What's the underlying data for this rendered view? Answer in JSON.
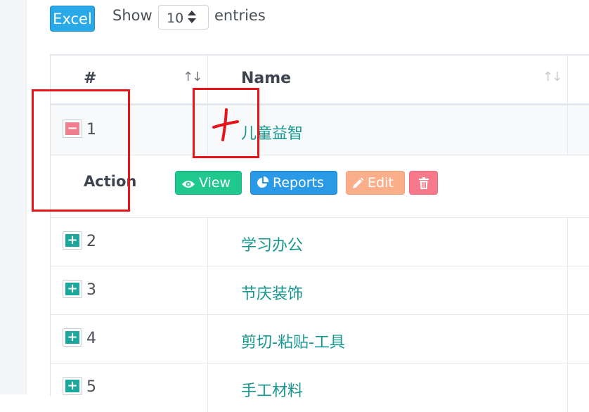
{
  "toolbar": {
    "excel_label": "Excel",
    "show_label": "Show",
    "entries_value": "10",
    "entries_label": "entries"
  },
  "table": {
    "columns": [
      {
        "label": "#"
      },
      {
        "label": "Name"
      }
    ],
    "rows": [
      {
        "num": "1",
        "name": "儿童益智",
        "expanded": true
      },
      {
        "num": "2",
        "name": "学习办公",
        "expanded": false
      },
      {
        "num": "3",
        "name": "节庆装饰",
        "expanded": false
      },
      {
        "num": "4",
        "name": "剪切-粘贴-工具",
        "expanded": false
      },
      {
        "num": "5",
        "name": "手工材料",
        "expanded": false
      }
    ],
    "detail": {
      "action_label": "Action",
      "view_label": "View",
      "reports_label": "Reports",
      "edit_label": "Edit"
    }
  },
  "colors": {
    "accent_teal": "#1aa89e",
    "annotation_red": "#e8141a",
    "excel_blue": "#2aa9e8"
  },
  "icons": [
    "sort-arrows-icon",
    "plus-icon",
    "minus-icon",
    "eye-icon",
    "pie-chart-icon",
    "pencil-icon",
    "trash-icon",
    "select-caret-icon"
  ]
}
